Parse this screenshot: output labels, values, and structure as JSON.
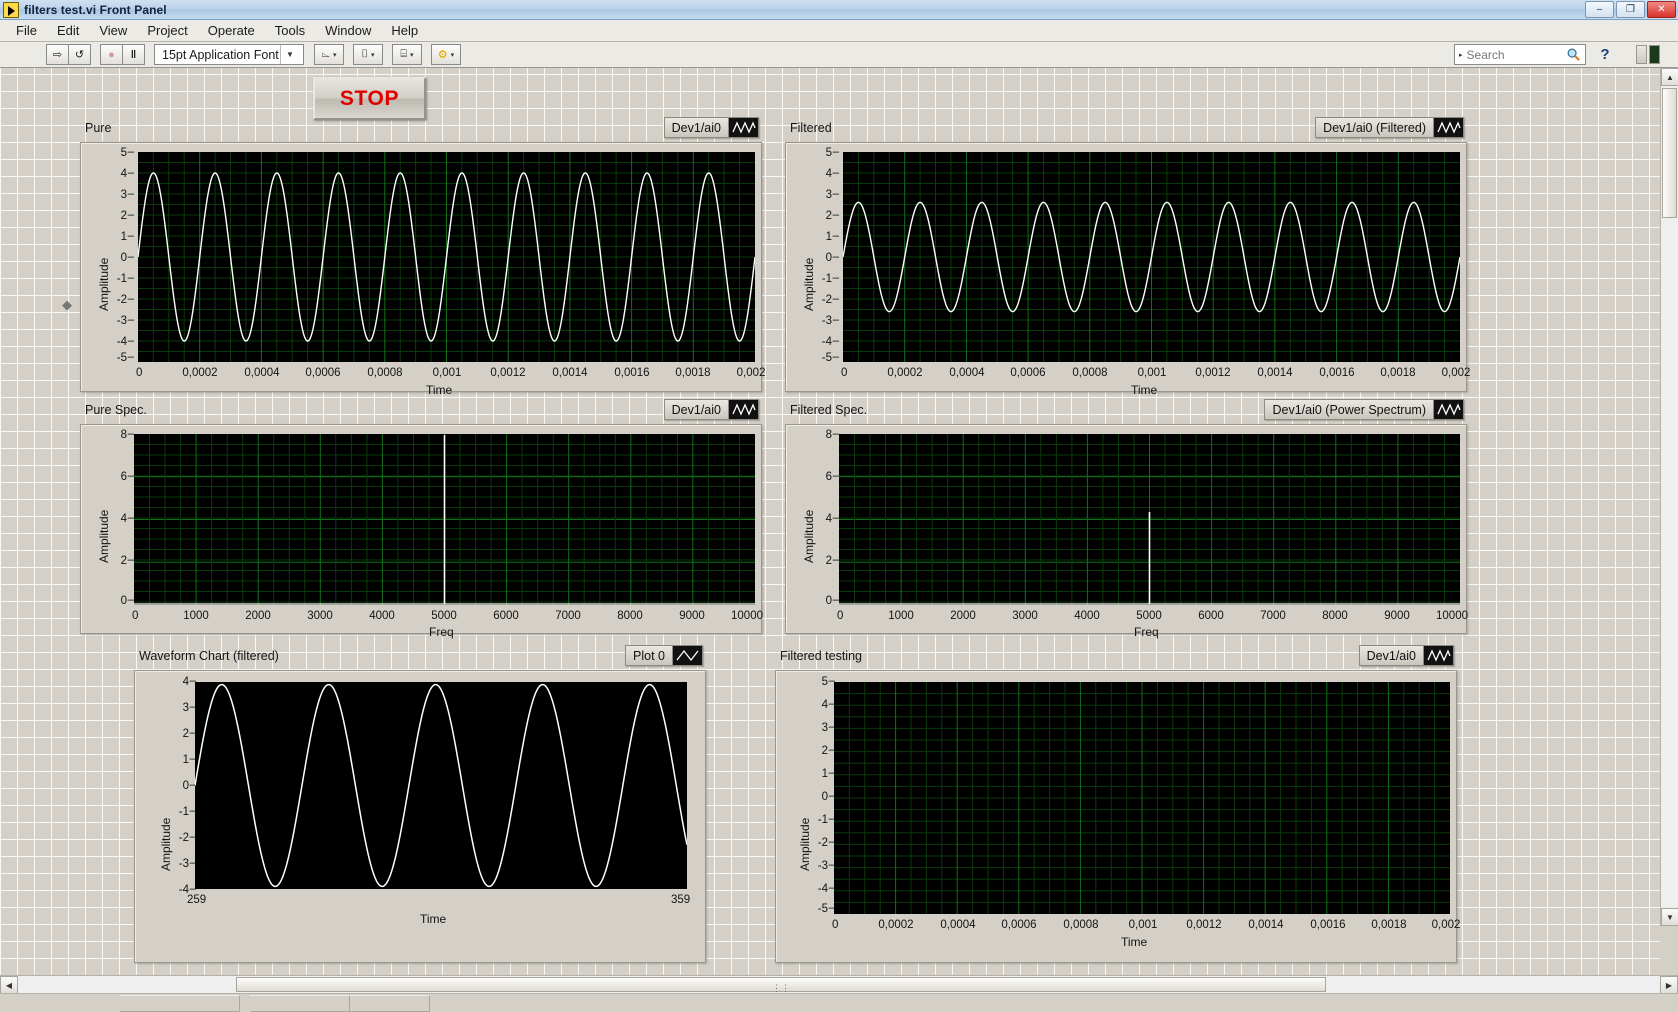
{
  "window": {
    "title": "filters test.vi Front Panel",
    "icon": "labview-vi-icon",
    "buttons": {
      "minimize": "–",
      "maximize": "❐",
      "close": "✕"
    }
  },
  "menu": {
    "items": [
      "File",
      "Edit",
      "View",
      "Project",
      "Operate",
      "Tools",
      "Window",
      "Help"
    ]
  },
  "toolbar": {
    "run_label": "⇨",
    "run_continuous_label": "↺",
    "abort_label": "●",
    "pause_label": "‖",
    "font_label": "15pt Application Font",
    "font_dropdown_arrow": "▼",
    "align_label": "⌳",
    "distribute_label": "⌷",
    "resize_label": "⌸",
    "reorder_label": "⚙",
    "caret": "▾"
  },
  "search": {
    "placeholder": "Search",
    "arrow": "▸",
    "icon": "search-icon"
  },
  "help": {
    "label": "?"
  },
  "controls": {
    "stop_button": "STOP"
  },
  "graphs": [
    {
      "id": "pure",
      "title": "Pure",
      "legend": "Dev1/ai0",
      "xlabel": "Time",
      "ylabel": "Amplitude",
      "yticks": [
        "5",
        "4",
        "3",
        "2",
        "1",
        "0",
        "-1",
        "-2",
        "-3",
        "-4",
        "-5"
      ],
      "xticks": [
        "0",
        "0,0002",
        "0,0004",
        "0,0006",
        "0,0008",
        "0,001",
        "0,0012",
        "0,0014",
        "0,0016",
        "0,0018",
        "0,002"
      ]
    },
    {
      "id": "filtered",
      "title": "Filtered",
      "legend": "Dev1/ai0 (Filtered)",
      "xlabel": "Time",
      "ylabel": "Amplitude",
      "yticks": [
        "5",
        "4",
        "3",
        "2",
        "1",
        "0",
        "-1",
        "-2",
        "-3",
        "-4",
        "-5"
      ],
      "xticks": [
        "0",
        "0,0002",
        "0,0004",
        "0,0006",
        "0,0008",
        "0,001",
        "0,0012",
        "0,0014",
        "0,0016",
        "0,0018",
        "0,002"
      ]
    },
    {
      "id": "pure-spec",
      "title": "Pure Spec.",
      "legend": "Dev1/ai0",
      "xlabel": "Freq",
      "ylabel": "Amplitude",
      "yticks": [
        "8",
        "6",
        "4",
        "2",
        "0"
      ],
      "xticks": [
        "0",
        "1000",
        "2000",
        "3000",
        "4000",
        "5000",
        "6000",
        "7000",
        "8000",
        "9000",
        "10000"
      ]
    },
    {
      "id": "filtered-spec",
      "title": "Filtered Spec.",
      "legend": "Dev1/ai0 (Power Spectrum)",
      "xlabel": "Freq",
      "ylabel": "Amplitude",
      "yticks": [
        "8",
        "6",
        "4",
        "2",
        "0"
      ],
      "xticks": [
        "0",
        "1000",
        "2000",
        "3000",
        "4000",
        "5000",
        "6000",
        "7000",
        "8000",
        "9000",
        "10000"
      ]
    },
    {
      "id": "waveform-chart",
      "title": "Waveform Chart (filtered)",
      "legend": "Plot 0",
      "xlabel": "Time",
      "ylabel": "Amplitude",
      "yticks": [
        "4",
        "3",
        "2",
        "1",
        "0",
        "-1",
        "-2",
        "-3",
        "-4"
      ],
      "xticks": [
        "259",
        "359"
      ]
    },
    {
      "id": "filtered-testing",
      "title": "Filtered testing",
      "legend": "Dev1/ai0",
      "xlabel": "Time",
      "ylabel": "Amplitude",
      "yticks": [
        "5",
        "4",
        "3",
        "2",
        "1",
        "0",
        "-1",
        "-2",
        "-3",
        "-4",
        "-5"
      ],
      "xticks": [
        "0",
        "0,0002",
        "0,0004",
        "0,0006",
        "0,0008",
        "0,001",
        "0,0012",
        "0,0014",
        "0,0016",
        "0,0018",
        "0,002"
      ]
    }
  ],
  "chart_data": [
    {
      "type": "line",
      "id": "pure",
      "title": "Pure",
      "xlabel": "Time",
      "ylabel": "Amplitude",
      "xlim": [
        0,
        0.002
      ],
      "ylim": [
        -5,
        5
      ],
      "grid": true,
      "legend": [
        "Dev1/ai0"
      ],
      "legend_position": "top-right",
      "series": [
        {
          "name": "Dev1/ai0",
          "waveform": "sine",
          "amplitude": 4.0,
          "frequency": 5000,
          "offset": 0,
          "phase": 0,
          "cycles": 10
        }
      ]
    },
    {
      "type": "line",
      "id": "filtered",
      "title": "Filtered",
      "xlabel": "Time",
      "ylabel": "Amplitude",
      "xlim": [
        0,
        0.002
      ],
      "ylim": [
        -5,
        5
      ],
      "grid": true,
      "legend": [
        "Dev1/ai0 (Filtered)"
      ],
      "legend_position": "top-right",
      "series": [
        {
          "name": "Dev1/ai0 (Filtered)",
          "waveform": "sine",
          "amplitude": 2.6,
          "frequency": 5000,
          "offset": 0,
          "phase": 0,
          "cycles": 10
        }
      ]
    },
    {
      "type": "line",
      "id": "pure-spec",
      "title": "Pure Spec.",
      "xlabel": "Freq",
      "ylabel": "Amplitude",
      "xlim": [
        0,
        10000
      ],
      "ylim": [
        0,
        8
      ],
      "grid": true,
      "legend": [
        "Dev1/ai0"
      ],
      "legend_position": "top-right",
      "series": [
        {
          "name": "Dev1/ai0",
          "peaks": [
            {
              "x": 5000,
              "y": 8.0
            }
          ],
          "baseline": 0
        }
      ]
    },
    {
      "type": "line",
      "id": "filtered-spec",
      "title": "Filtered Spec.",
      "xlabel": "Freq",
      "ylabel": "Amplitude",
      "xlim": [
        0,
        10000
      ],
      "ylim": [
        0,
        8
      ],
      "grid": true,
      "legend": [
        "Dev1/ai0 (Power Spectrum)"
      ],
      "legend_position": "top-right",
      "series": [
        {
          "name": "Dev1/ai0 (Power Spectrum)",
          "peaks": [
            {
              "x": 5000,
              "y": 4.3
            }
          ],
          "baseline": 0
        }
      ]
    },
    {
      "type": "line",
      "id": "waveform-chart",
      "title": "Waveform Chart (filtered)",
      "xlabel": "Time",
      "ylabel": "Amplitude",
      "xlim": [
        259,
        359
      ],
      "ylim": [
        -4,
        4
      ],
      "grid": false,
      "legend": [
        "Plot 0"
      ],
      "legend_position": "top-right",
      "series": [
        {
          "name": "Plot 0",
          "waveform": "sine",
          "amplitude": 3.9,
          "cycles": 4.6,
          "offset": 0,
          "phase": 0
        }
      ]
    },
    {
      "type": "line",
      "id": "filtered-testing",
      "title": "Filtered testing",
      "xlabel": "Time",
      "ylabel": "Amplitude",
      "xlim": [
        0,
        0.002
      ],
      "ylim": [
        -5,
        5
      ],
      "grid": true,
      "legend": [
        "Dev1/ai0"
      ],
      "legend_position": "top-right",
      "series": [
        {
          "name": "Dev1/ai0",
          "values": [],
          "note": "empty - no data plotted"
        }
      ]
    }
  ],
  "scrollbars": {
    "v_up": "▲",
    "v_down": "▼",
    "h_left": "◀",
    "h_right": "▶",
    "h_grip": "⋮⋮"
  }
}
